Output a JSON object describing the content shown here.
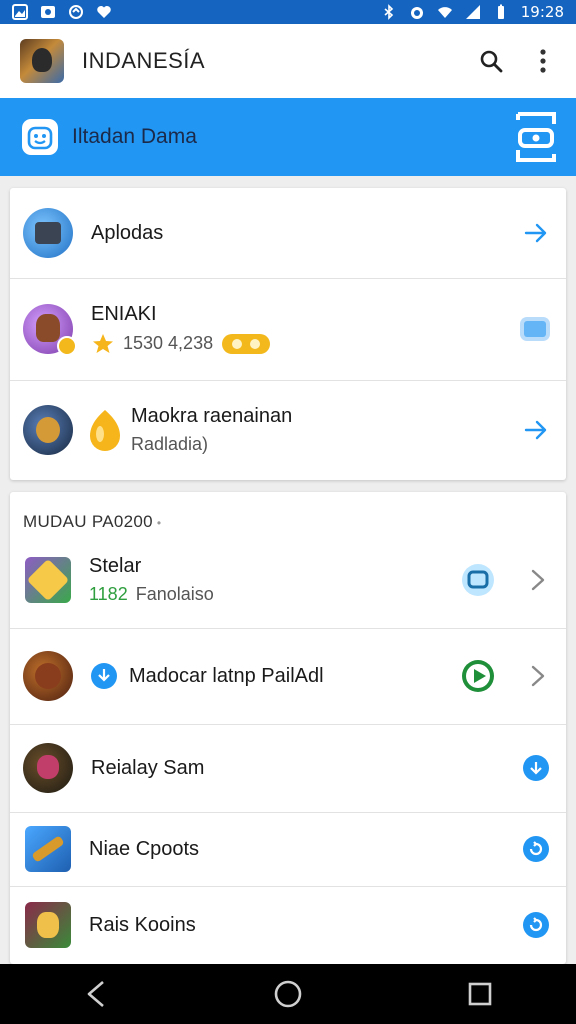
{
  "status_bar": {
    "time": "19:28"
  },
  "app_bar": {
    "title": "INDANESÍA"
  },
  "banner": {
    "text": "Iltadan Dama"
  },
  "section1": {
    "rows": [
      {
        "title": "Aplodas"
      },
      {
        "title": "ENIAKI",
        "stats": "1530 4,238"
      },
      {
        "title": "Maokra raenainan",
        "subtitle": "Radladia)"
      }
    ]
  },
  "section2": {
    "header": "MUDAU PA0200",
    "rows": [
      {
        "title": "Stelar",
        "sub_accent": "1182",
        "sub_text": "Fanolaiso"
      },
      {
        "title": "Madocar latnp PailAdl"
      },
      {
        "title": "Reialay Sam"
      },
      {
        "title": "Niae Cpoots"
      },
      {
        "title": "Rais Kooins"
      }
    ]
  },
  "colors": {
    "status_bar": "#1565c0",
    "banner": "#2196f3",
    "accent_blue": "#2196f3",
    "accent_green": "#2e9e3e",
    "gold": "#f2b81c"
  }
}
